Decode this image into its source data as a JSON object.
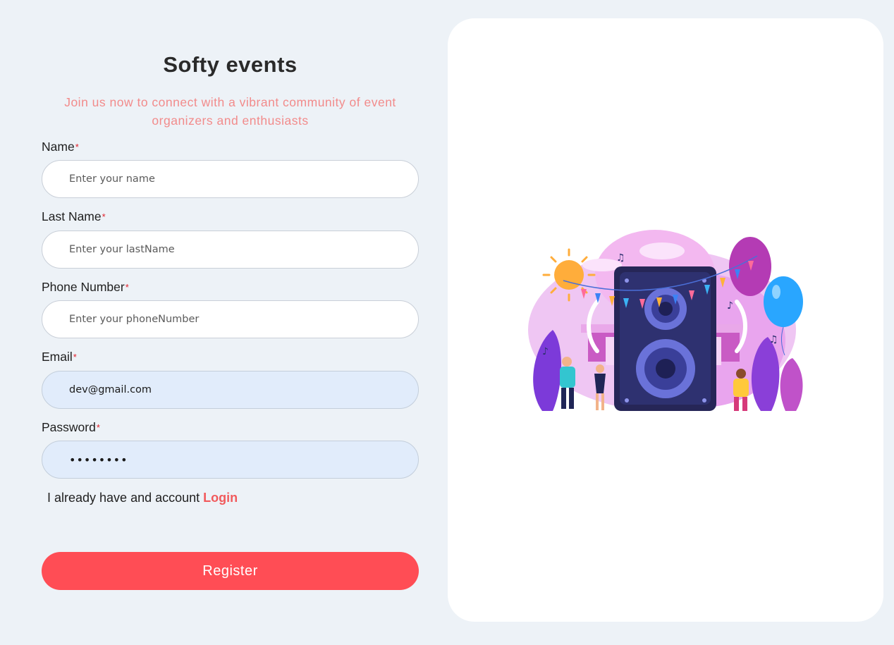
{
  "app": {
    "title": "Softy events",
    "subtitle": "Join us now to connect with a vibrant community of event organizers and enthusiasts"
  },
  "form": {
    "required_marker": "*",
    "fields": [
      {
        "label": "Name",
        "placeholder": "Enter your name",
        "value": ""
      },
      {
        "label": "Last Name",
        "placeholder": "Enter your lastName",
        "value": ""
      },
      {
        "label": "Phone Number",
        "placeholder": "Enter your phoneNumber",
        "value": ""
      },
      {
        "label": "Email",
        "placeholder": "",
        "value": "dev@gmail.com"
      },
      {
        "label": "Password",
        "placeholder": "",
        "value": "********"
      }
    ],
    "account_prompt": "I already have and account",
    "login_link": "Login",
    "register_button": "Register"
  },
  "colors": {
    "background": "#edf2f7",
    "accent": "#ff4d55",
    "subtitle": "#f28b8b",
    "autofill": "#e1ecfb"
  },
  "illustration": {
    "icon": "party-speaker-illustration"
  }
}
